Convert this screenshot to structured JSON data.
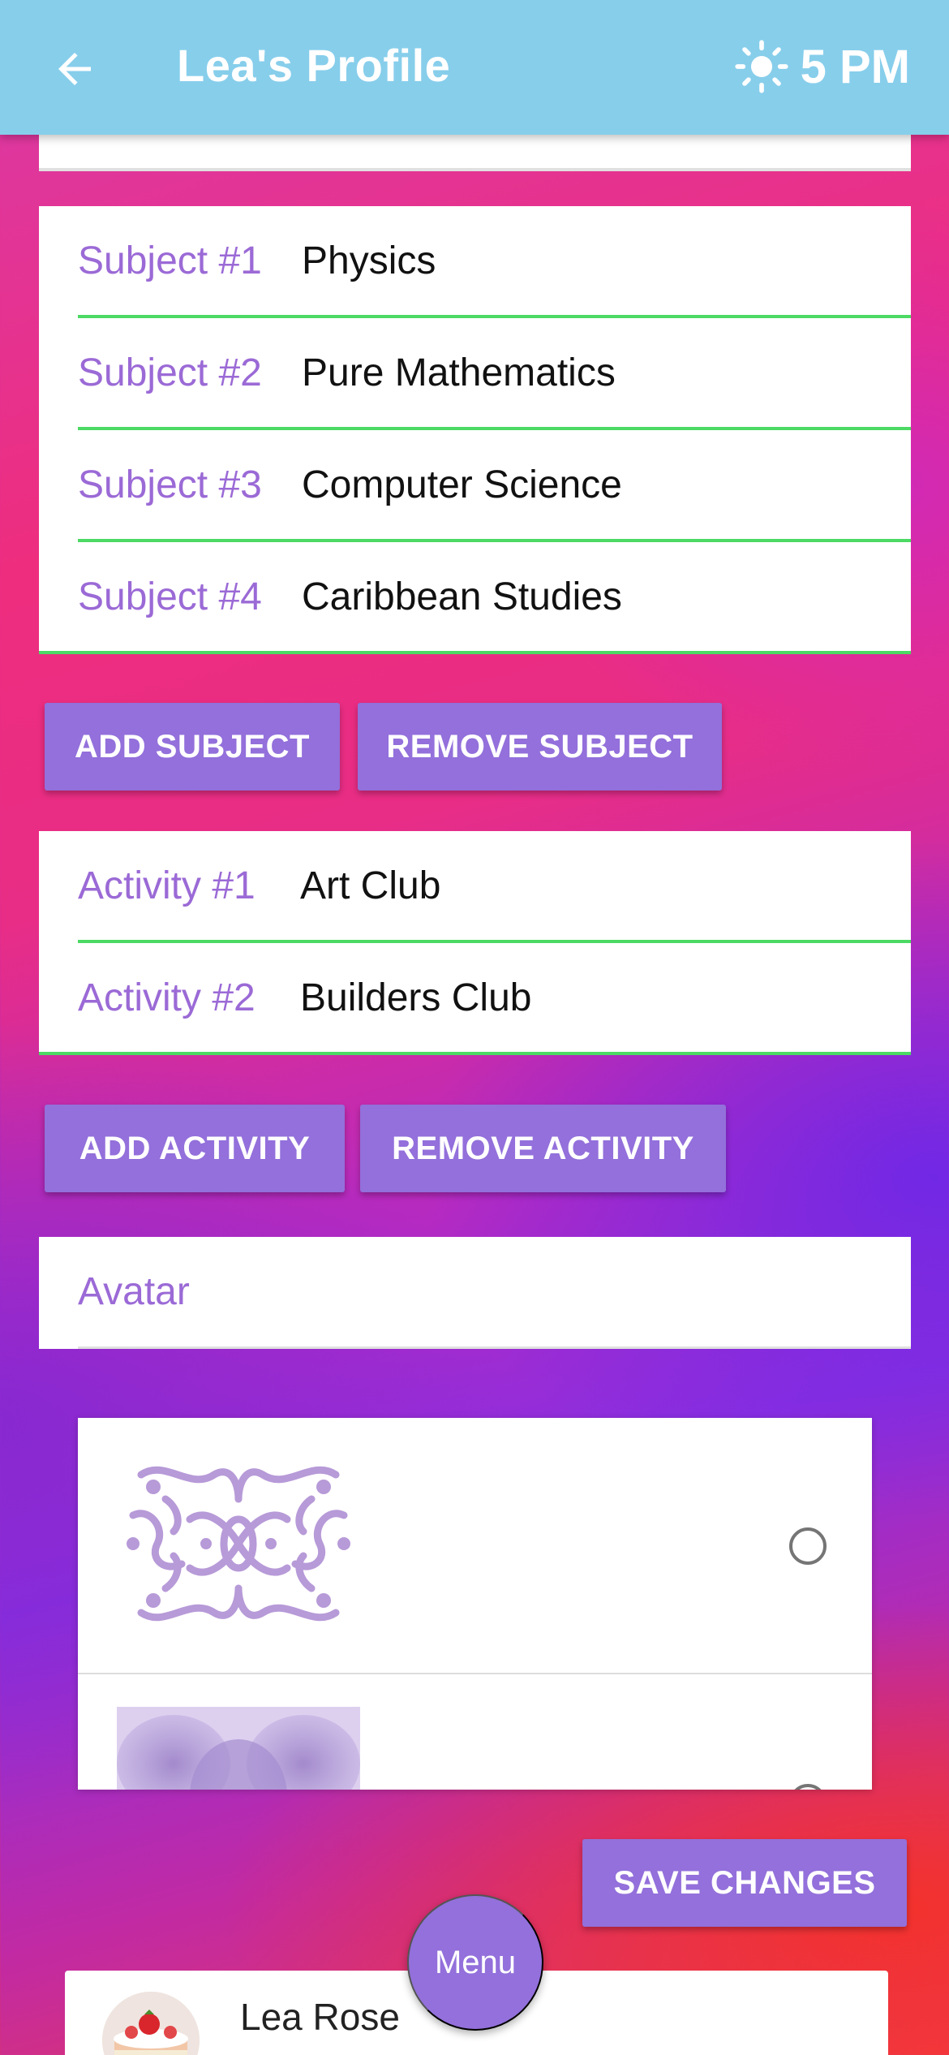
{
  "appbar": {
    "title": "Lea's Profile",
    "time": "5 PM",
    "back_icon": "arrow-left-icon",
    "weather_icon": "sun-icon",
    "background": "#87ceeb"
  },
  "subjects": [
    {
      "label": "Subject #1",
      "value": "Physics"
    },
    {
      "label": "Subject #2",
      "value": "Pure Mathematics"
    },
    {
      "label": "Subject #3",
      "value": "Computer Science"
    },
    {
      "label": "Subject #4",
      "value": "Caribbean Studies"
    }
  ],
  "subject_buttons": {
    "add": "ADD SUBJECT",
    "remove": "REMOVE SUBJECT"
  },
  "activities": [
    {
      "label": "Activity #1",
      "value": "Art Club"
    },
    {
      "label": "Activity #2",
      "value": "Builders Club"
    }
  ],
  "activity_buttons": {
    "add": "ADD ACTIVITY",
    "remove": "REMOVE ACTIVITY"
  },
  "avatar": {
    "label": "Avatar",
    "options": [
      {
        "icon": "ornamental-pattern-icon",
        "selected": false
      },
      {
        "icon": "watercolor-pattern-icon",
        "selected": false
      }
    ]
  },
  "save_button": "SAVE CHANGES",
  "menu_button": "Menu",
  "user": {
    "name": "Lea Rose",
    "avatar_icon": "cake-avatar-icon"
  },
  "colors": {
    "accent": "#9370db",
    "label": "#9b6ad6",
    "underline": "#4cd964"
  }
}
